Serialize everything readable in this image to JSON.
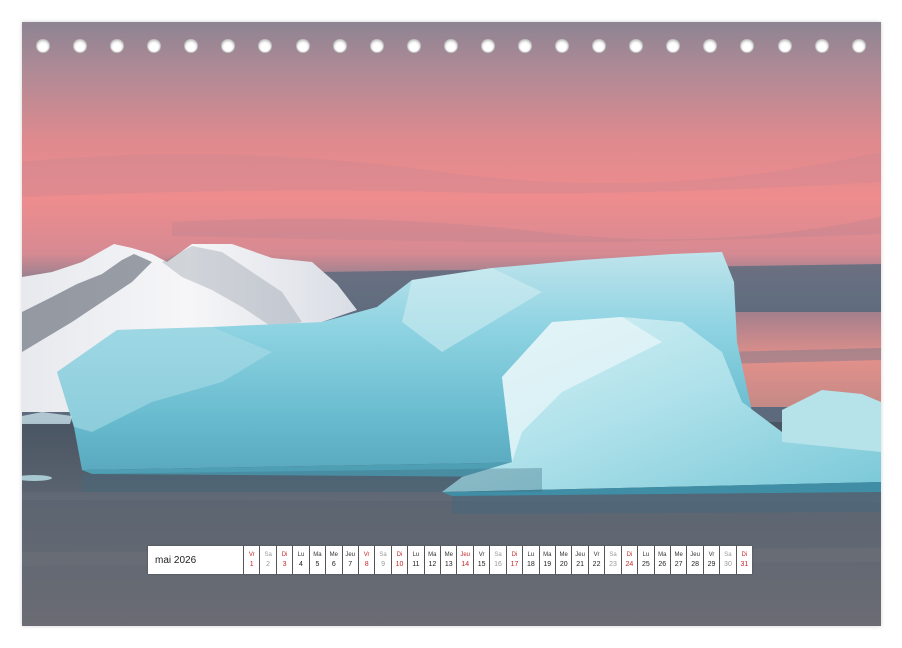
{
  "calendar": {
    "month_label": "mai 2026",
    "days": [
      {
        "name": "Vr",
        "num": "1",
        "type": "hol"
      },
      {
        "name": "Sa",
        "num": "2",
        "type": "sat"
      },
      {
        "name": "Di",
        "num": "3",
        "type": "hol"
      },
      {
        "name": "Lu",
        "num": "4",
        "type": "work"
      },
      {
        "name": "Ma",
        "num": "5",
        "type": "work"
      },
      {
        "name": "Me",
        "num": "6",
        "type": "work"
      },
      {
        "name": "Jeu",
        "num": "7",
        "type": "work"
      },
      {
        "name": "Vr",
        "num": "8",
        "type": "hol"
      },
      {
        "name": "Sa",
        "num": "9",
        "type": "sat"
      },
      {
        "name": "Di",
        "num": "10",
        "type": "hol"
      },
      {
        "name": "Lu",
        "num": "11",
        "type": "work"
      },
      {
        "name": "Ma",
        "num": "12",
        "type": "work"
      },
      {
        "name": "Me",
        "num": "13",
        "type": "work"
      },
      {
        "name": "Jeu",
        "num": "14",
        "type": "hol"
      },
      {
        "name": "Vr",
        "num": "15",
        "type": "work"
      },
      {
        "name": "Sa",
        "num": "16",
        "type": "sat"
      },
      {
        "name": "Di",
        "num": "17",
        "type": "hol"
      },
      {
        "name": "Lu",
        "num": "18",
        "type": "work"
      },
      {
        "name": "Ma",
        "num": "19",
        "type": "work"
      },
      {
        "name": "Me",
        "num": "20",
        "type": "work"
      },
      {
        "name": "Jeu",
        "num": "21",
        "type": "work"
      },
      {
        "name": "Vr",
        "num": "22",
        "type": "work"
      },
      {
        "name": "Sa",
        "num": "23",
        "type": "sat"
      },
      {
        "name": "Di",
        "num": "24",
        "type": "hol"
      },
      {
        "name": "Lu",
        "num": "25",
        "type": "work"
      },
      {
        "name": "Ma",
        "num": "26",
        "type": "work"
      },
      {
        "name": "Me",
        "num": "27",
        "type": "work"
      },
      {
        "name": "Jeu",
        "num": "28",
        "type": "work"
      },
      {
        "name": "Vr",
        "num": "29",
        "type": "work"
      },
      {
        "name": "Sa",
        "num": "30",
        "type": "sat"
      },
      {
        "name": "Di",
        "num": "31",
        "type": "hol"
      }
    ]
  },
  "colors": {
    "holiday": "#c62828",
    "saturday": "#999999",
    "text": "#222222"
  },
  "binding": {
    "hole_count": 23
  }
}
